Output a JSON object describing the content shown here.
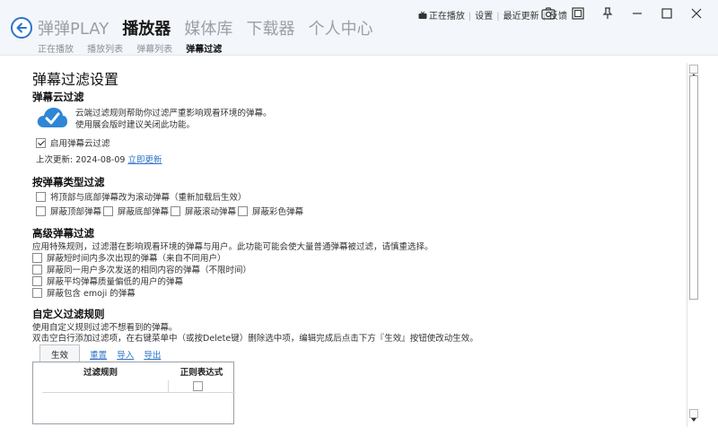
{
  "nav": {
    "items": [
      "弹弹PLAY",
      "播放器",
      "媒体库",
      "下载器",
      "个人中心"
    ],
    "active": 1,
    "sub_items": [
      "正在播放",
      "播放列表",
      "弹幕列表",
      "弹幕过滤"
    ],
    "sub_active": 3
  },
  "topbar": {
    "now_playing": "正在播放",
    "settings": "设置",
    "updates": "最近更新",
    "feedback": "反馈"
  },
  "page": {
    "title": "弹幕过滤设置",
    "cloud": {
      "heading": "弹幕云过滤",
      "desc1": "云端过滤规则帮助你过滤严重影响观看环境的弹幕。",
      "desc2": "使用展会版时建议关闭此功能。",
      "enable_label": "启用弹幕云过滤",
      "enable_checked": true,
      "last_update_label": "上次更新: 2024-08-09",
      "update_now": "立即更新"
    },
    "type_filter": {
      "heading": "按弹幕类型过滤",
      "convert_label": "将顶部与底部弹幕改为滚动弹幕（重新加载后生效）",
      "options": [
        "屏蔽顶部弹幕",
        "屏蔽底部弹幕",
        "屏蔽滚动弹幕",
        "屏蔽彩色弹幕"
      ]
    },
    "advanced": {
      "heading": "高级弹幕过滤",
      "desc": "应用特殊规则，过滤潜在影响观看环境的弹幕与用户。此功能可能会使大量普通弹幕被过滤，请慎重选择。",
      "options": [
        "屏蔽短时间内多次出现的弹幕（来自不同用户）",
        "屏蔽同一用户多次发送的相同内容的弹幕（不限时间）",
        "屏蔽平均弹幕质量偏低的用户的弹幕",
        "屏蔽包含 emoji 的弹幕"
      ]
    },
    "custom": {
      "heading": "自定义过滤规则",
      "desc1": "使用自定义规则过滤不想看到的弹幕。",
      "desc2": "双击空白行添加过滤项，在右键菜单中（或按Delete键）删除选中项，编辑完成后点击下方『生效』按钮使改动生效。",
      "apply": "生效",
      "reset": "重置",
      "import": "导入",
      "export": "导出",
      "col_rule": "过滤规则",
      "col_regex": "正则表达式"
    }
  },
  "colors": {
    "accent": "#2f74c8",
    "header_bg": "#f3f6fa"
  }
}
